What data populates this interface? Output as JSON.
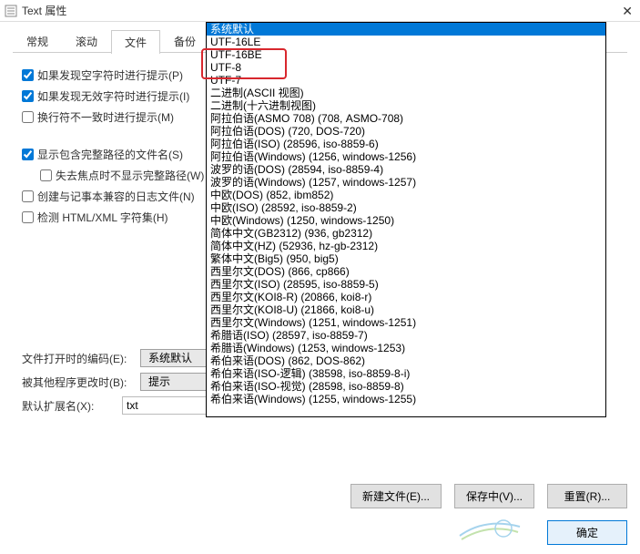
{
  "window": {
    "title": "Text 属性"
  },
  "tabs": {
    "t0": "常规",
    "t1": "滚动",
    "t2": "文件",
    "t3": "备份"
  },
  "checkboxes": {
    "c0": "如果发现空字符时进行提示(P)",
    "c1": "如果发现无效字符时进行提示(I)",
    "c2": "换行符不一致时进行提示(M)",
    "c3": "显示包含完整路径的文件名(S)",
    "c4": "失去焦点时不显示完整路径(W)",
    "c5": "创建与记事本兼容的日志文件(N)",
    "c6": "检测 HTML/XML 字符集(H)"
  },
  "fields": {
    "encoding_label": "文件打开时的编码(E):",
    "encoding_value": "系统默认",
    "changed_label": "被其他程序更改时(B):",
    "changed_value": "提示",
    "ext_label": "默认扩展名(X):",
    "ext_value": "txt"
  },
  "buttons": {
    "new": "新建文件(E)...",
    "saving": "保存中(V)...",
    "reset": "重置(R)...",
    "ok": "确定"
  },
  "dropdown": [
    "系统默认",
    "UTF-16LE",
    "UTF-16BE",
    "UTF-8",
    "UTF-7",
    "二进制(ASCII 视图)",
    "二进制(十六进制视图)",
    "阿拉伯语(ASMO 708) (708, ASMO-708)",
    "阿拉伯语(DOS) (720, DOS-720)",
    "阿拉伯语(ISO) (28596, iso-8859-6)",
    "阿拉伯语(Windows) (1256, windows-1256)",
    "波罗的语(DOS) (28594, iso-8859-4)",
    "波罗的语(Windows) (1257, windows-1257)",
    "中欧(DOS) (852, ibm852)",
    "中欧(ISO) (28592, iso-8859-2)",
    "中欧(Windows) (1250, windows-1250)",
    "简体中文(GB2312) (936, gb2312)",
    "简体中文(HZ) (52936, hz-gb-2312)",
    "繁体中文(Big5) (950, big5)",
    "西里尔文(DOS) (866, cp866)",
    "西里尔文(ISO) (28595, iso-8859-5)",
    "西里尔文(KOI8-R) (20866, koi8-r)",
    "西里尔文(KOI8-U) (21866, koi8-u)",
    "西里尔文(Windows) (1251, windows-1251)",
    "希腊语(ISO) (28597, iso-8859-7)",
    "希腊语(Windows) (1253, windows-1253)",
    "希伯来语(DOS) (862, DOS-862)",
    "希伯来语(ISO-逻辑) (38598, iso-8859-8-i)",
    "希伯来语(ISO-视觉) (28598, iso-8859-8)",
    "希伯来语(Windows) (1255, windows-1255)"
  ]
}
